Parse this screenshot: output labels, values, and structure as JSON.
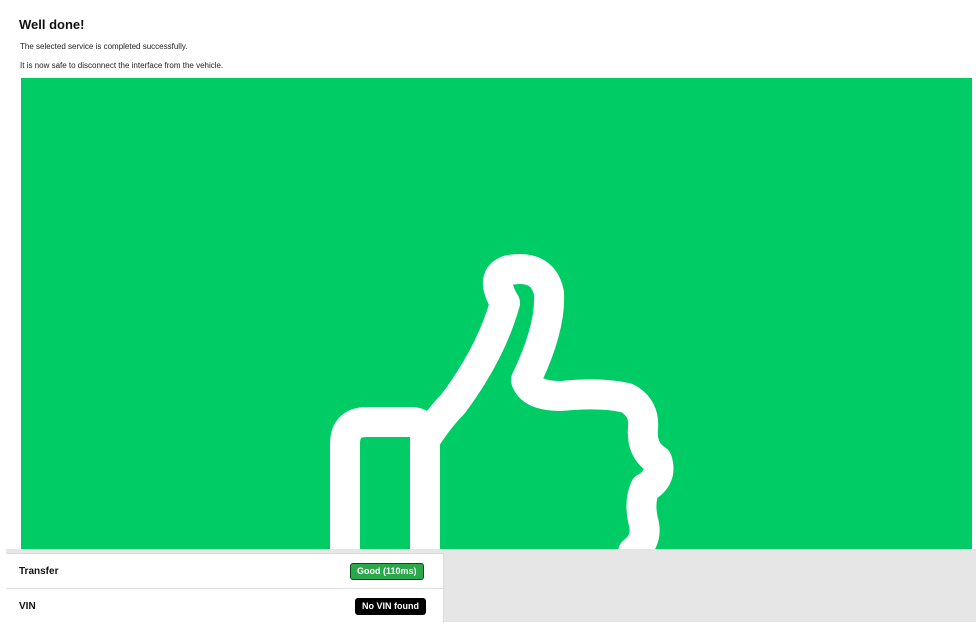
{
  "message": {
    "title": "Well done!",
    "line1": "The selected service is completed successfully.",
    "line2": "It is now safe to disconnect the interface from the vehicle."
  },
  "hero": {
    "icon": "thumbs-up-icon",
    "background_color": "#00cc66",
    "icon_color": "#ffffff"
  },
  "status": {
    "rows": [
      {
        "label": "Transfer",
        "value": "Good (110ms)",
        "color": "#2aa84a"
      },
      {
        "label": "VIN",
        "value": "No VIN found",
        "color": "#000000"
      }
    ]
  }
}
